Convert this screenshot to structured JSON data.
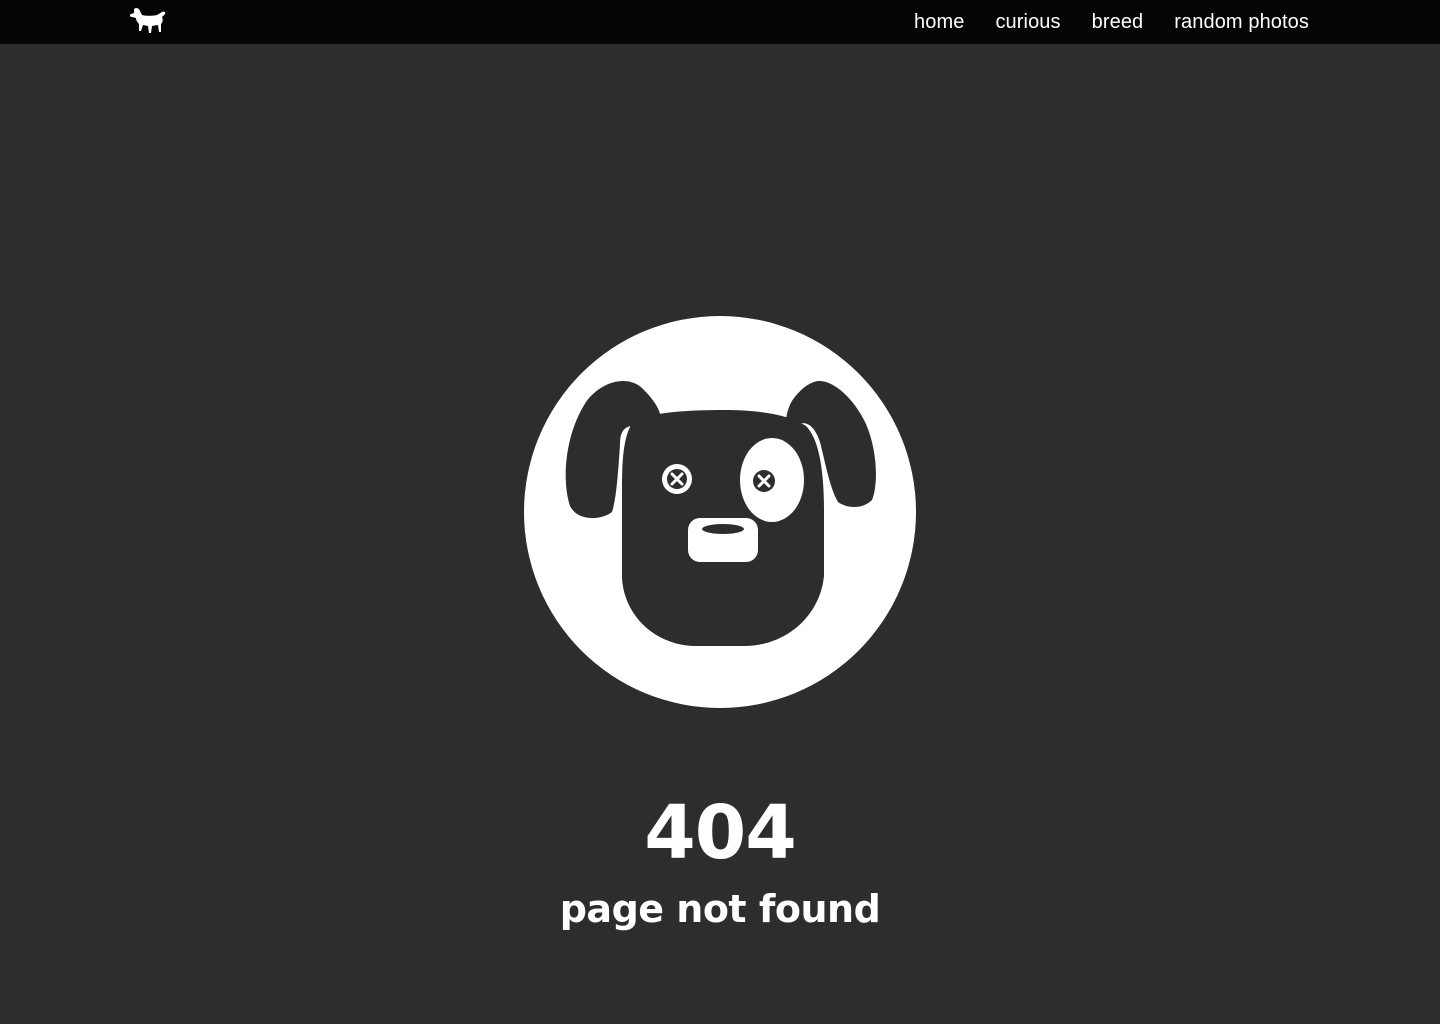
{
  "header": {
    "logo_icon": "dog-silhouette-icon",
    "nav": [
      {
        "label": "home"
      },
      {
        "label": "curious"
      },
      {
        "label": "breed"
      },
      {
        "label": "random photos"
      }
    ]
  },
  "main": {
    "illustration_icon": "sad-dog-face-icon",
    "code": "404",
    "message": "page not found"
  },
  "colors": {
    "background": "#2d2d2d",
    "header": "#050505",
    "foreground": "#ffffff"
  }
}
